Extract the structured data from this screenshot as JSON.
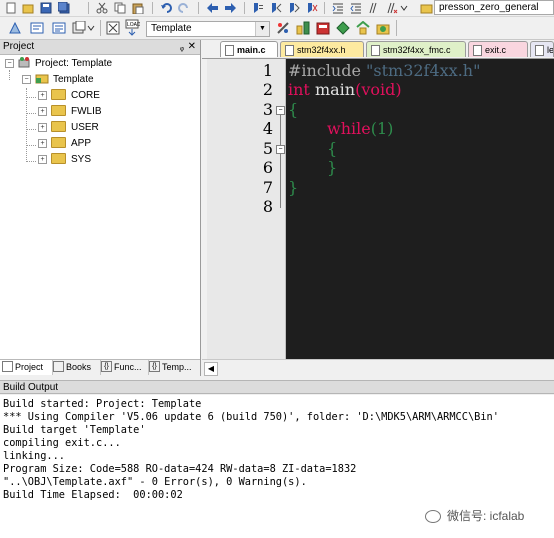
{
  "toolbar": {
    "target_combo": "Template",
    "target_name": "presson_zero_general"
  },
  "project_pane": {
    "title": "Project",
    "root": "Project: Template",
    "target": "Template",
    "groups": [
      "CORE",
      "FWLIB",
      "USER",
      "APP",
      "SYS"
    ],
    "tabs": [
      "Project",
      "Books",
      "Func...",
      "Temp..."
    ]
  },
  "editor": {
    "tabs": [
      "main.c",
      "stm32f4xx.h",
      "stm32f4xx_fmc.c",
      "exit.c",
      "le"
    ],
    "active_tab": "main.c",
    "line_numbers": [
      "1",
      "2",
      "3",
      "4",
      "5",
      "6",
      "7",
      "8"
    ],
    "code": {
      "l1_directive": "#include ",
      "l1_header": "\"stm32f4xx.h\"",
      "l2_type": "int",
      "l2_func": " main",
      "l2_open": "(",
      "l2_param": "void",
      "l2_close": ")",
      "l3": "{",
      "l4_kw": "while",
      "l4_arg": "(1)",
      "l5": "{",
      "l6": "}",
      "l7": "}"
    }
  },
  "build_output": {
    "title": "Build Output",
    "lines": [
      "Build started: Project: Template",
      "*** Using Compiler 'V5.06 update 6 (build 750)', folder: 'D:\\MDK5\\ARM\\ARMCC\\Bin'",
      "Build target 'Template'",
      "compiling exit.c...",
      "linking...",
      "Program Size: Code=588 RO-data=424 RW-data=8 ZI-data=1832",
      "\"..\\OBJ\\Template.axf\" - 0 Error(s), 0 Warning(s).",
      "Build Time Elapsed:  00:00:02"
    ]
  },
  "watermark": "微信号: icfalab",
  "colors": {
    "editor_bg": "#1e1e1e",
    "keyword": "#e0105c",
    "preprocessor": "#a8a8a8",
    "brace": "#2e8c4c"
  }
}
